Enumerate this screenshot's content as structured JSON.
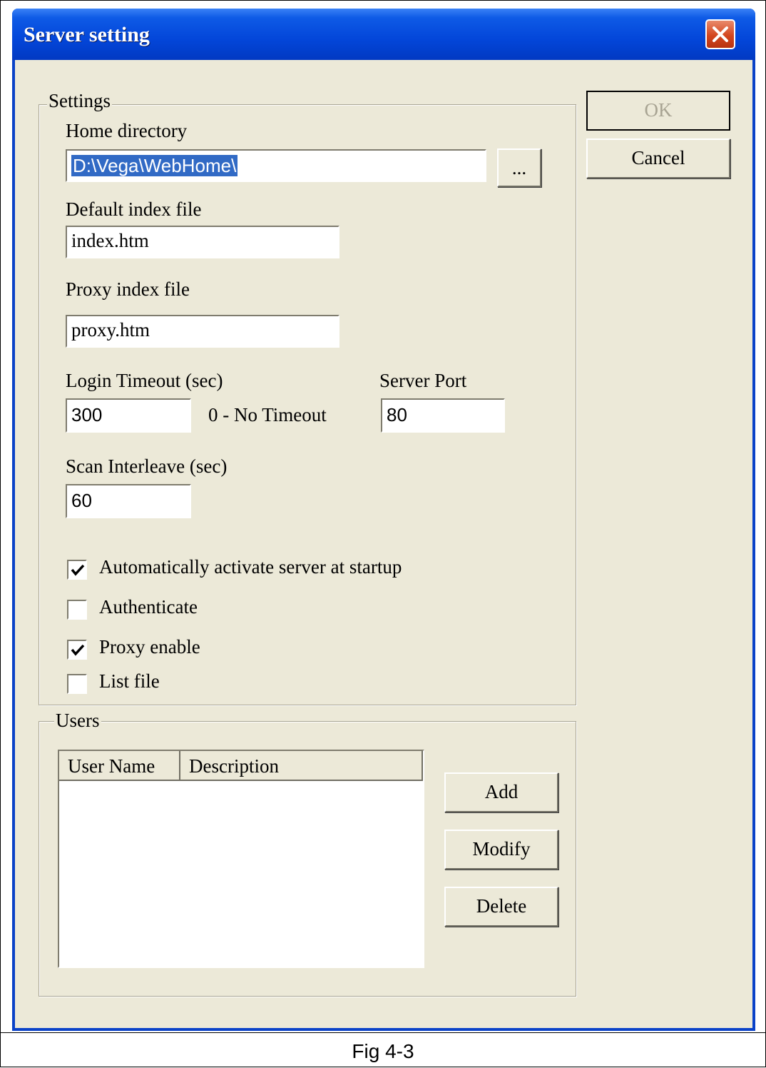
{
  "window": {
    "title": "Server setting"
  },
  "settings": {
    "group_title": "Settings",
    "home_directory": {
      "label": "Home directory",
      "value": "D:\\Vega\\WebHome\\",
      "browse_label": "..."
    },
    "default_index": {
      "label": "Default index file",
      "value": "index.htm"
    },
    "proxy_index": {
      "label": "Proxy index file",
      "value": "proxy.htm"
    },
    "login_timeout": {
      "label": "Login Timeout (sec)",
      "value": "300",
      "hint": "0 - No Timeout"
    },
    "server_port": {
      "label": "Server Port",
      "value": "80"
    },
    "scan_interleave": {
      "label": "Scan Interleave (sec)",
      "value": "60"
    },
    "checkboxes": [
      {
        "label": "Automatically activate server at startup",
        "checked": true
      },
      {
        "label": "Authenticate",
        "checked": false
      },
      {
        "label": "Proxy enable",
        "checked": true
      },
      {
        "label": "List file",
        "checked": false
      }
    ]
  },
  "users": {
    "group_title": "Users",
    "columns": [
      "User Name",
      "Description"
    ],
    "rows": [],
    "add_label": "Add",
    "modify_label": "Modify",
    "delete_label": "Delete"
  },
  "dialog_buttons": {
    "ok_label": "OK",
    "cancel_label": "Cancel"
  },
  "caption": "Fig 4-3"
}
